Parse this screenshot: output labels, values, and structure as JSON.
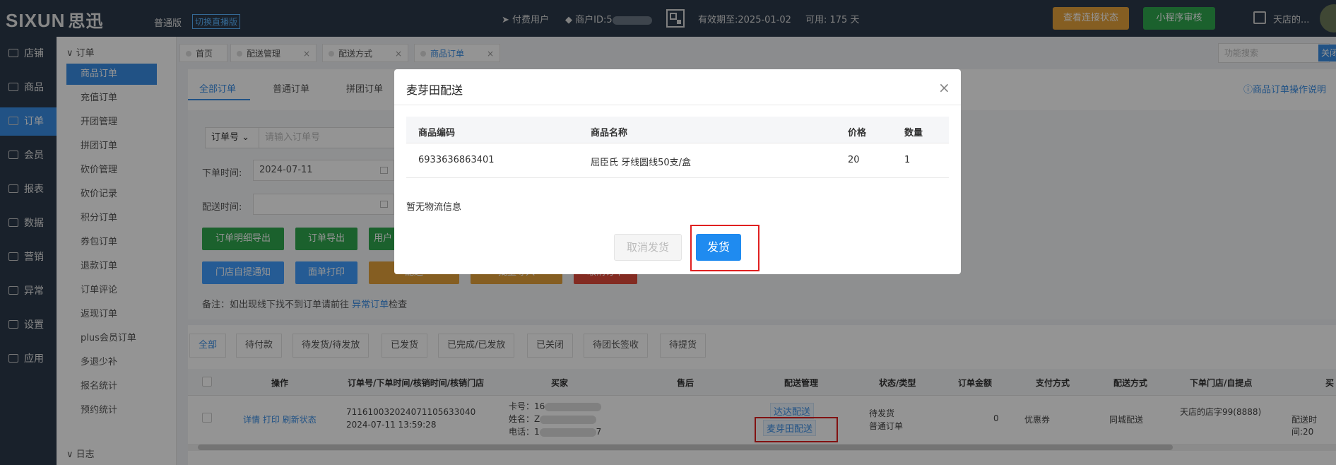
{
  "topbar": {
    "logo": "SIXUN",
    "logo_cn": "思迅",
    "edition": "普通版",
    "switch_live": "切换直播版",
    "paid_user": "付费用户",
    "merchant_id_label": "商户ID:5",
    "valid_until": "有效期至:2025-01-02",
    "available": "可用: 175 天",
    "btn_connection": "查看连接状态",
    "btn_miniprogram": "小程序审核",
    "shop_name": "天店的..."
  },
  "sidenav": {
    "items": [
      {
        "label": "店铺"
      },
      {
        "label": "商品"
      },
      {
        "label": "订单"
      },
      {
        "label": "会员"
      },
      {
        "label": "报表"
      },
      {
        "label": "数据"
      },
      {
        "label": "营销"
      },
      {
        "label": "异常"
      },
      {
        "label": "设置"
      },
      {
        "label": "应用"
      }
    ]
  },
  "submenu": {
    "group": "订单",
    "items": [
      {
        "label": "商品订单"
      },
      {
        "label": "充值订单"
      },
      {
        "label": "开团管理"
      },
      {
        "label": "拼团订单"
      },
      {
        "label": "砍价管理"
      },
      {
        "label": "砍价记录"
      },
      {
        "label": "积分订单"
      },
      {
        "label": "券包订单"
      },
      {
        "label": "退款订单"
      },
      {
        "label": "订单评论"
      },
      {
        "label": "返现订单"
      },
      {
        "label": "plus会员订单"
      },
      {
        "label": "多退少补"
      },
      {
        "label": "报名统计"
      },
      {
        "label": "预约统计"
      }
    ],
    "group2": "日志"
  },
  "pagetabs": {
    "items": [
      {
        "label": "首页"
      },
      {
        "label": "配送管理"
      },
      {
        "label": "配送方式"
      },
      {
        "label": "商品订单"
      }
    ],
    "close": "×",
    "function_search": "功能搜索",
    "close_edge": "关闭"
  },
  "ordertabs": {
    "items": [
      {
        "label": "全部订单"
      },
      {
        "label": "普通订单"
      },
      {
        "label": "拼团订单"
      }
    ],
    "help": "商品订单操作说明"
  },
  "filters": {
    "order_select": "订单号",
    "order_placeholder": "请输入订单号",
    "order_time_label": "下单时间:",
    "order_time_value": "2024-07-11",
    "delivery_time_label": "配送时间:"
  },
  "buttons": {
    "detail_export": "订单明细导出",
    "order_export": "订单导出",
    "user_partial": "用户",
    "pickup_notify": "门店自提通知",
    "waybill_print": "面单打印",
    "delivery_partial": "配送",
    "other_partial": "批量导入",
    "cancel_partial": "取消订单"
  },
  "note": {
    "prefix": "备注：如出现线下找不到订单请前往",
    "link": "异常订单",
    "suffix": "检查"
  },
  "statustabs": {
    "items": [
      {
        "label": "全部"
      },
      {
        "label": "待付款"
      },
      {
        "label": "待发货/待发放"
      },
      {
        "label": "已发货"
      },
      {
        "label": "已完成/已发放"
      },
      {
        "label": "已关闭"
      },
      {
        "label": "待团长签收"
      },
      {
        "label": "待提货"
      }
    ]
  },
  "table": {
    "headers": {
      "action": "操作",
      "order": "订单号/下单时间/核销时间/核销门店",
      "buyer": "买家",
      "aftersale": "售后",
      "delivery": "配送管理",
      "status": "状态/类型",
      "amount": "订单金额",
      "payment": "支付方式",
      "method": "配送方式",
      "store": "下单门店/自提点",
      "extra": "买"
    },
    "row": {
      "actions": [
        "详情",
        "打印",
        "刷新状态"
      ],
      "order_no": "71161003202407110563304​0",
      "order_time": "2024-07-11 13:59:28",
      "card_label": "卡号：16",
      "name_label": "姓名：Z",
      "phone_label": "电话：1",
      "phone_tail": "7",
      "delivery_dada": "达达配送",
      "delivery_maiyatian": "麦芽田配送",
      "status": "待发货",
      "type": "普通订单",
      "amount": "0",
      "payment": "优惠券",
      "method": "同城配送",
      "store": "天店的店字99(8888)",
      "extra": "配送时间:20"
    }
  },
  "modal": {
    "title": "麦芽田配送",
    "close": "×",
    "headers": {
      "code": "商品编码",
      "name": "商品名称",
      "price": "价格",
      "qty": "数量"
    },
    "rows": [
      {
        "code": "6933636863401",
        "name": "屈臣氏 牙线圆线50支/盒",
        "price": "20",
        "qty": "1"
      }
    ],
    "no_logistics": "暂无物流信息",
    "btn_cancel": "取消发货",
    "btn_ship": "发货"
  }
}
